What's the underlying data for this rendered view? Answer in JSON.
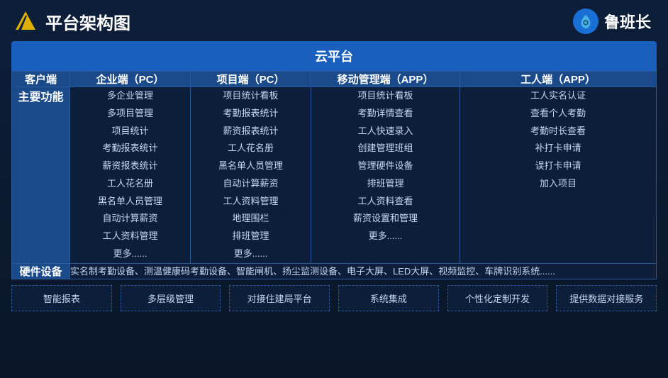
{
  "header": {
    "title": "平台架构图",
    "brand_name": "鲁班长"
  },
  "cloud_platform_label": "云平台",
  "columns": {
    "client": "客户端",
    "enterprise_pc": "企业端（PC）",
    "project_pc": "项目端（PC）",
    "mobile_app": "移动管理端（APP）",
    "worker_app": "工人端（APP）"
  },
  "main_function_label": "主要功能",
  "hardware_label": "硬件设备",
  "enterprise_functions": [
    "多企业管理",
    "多项目管理",
    "项目统计",
    "考勤报表统计",
    "薪资报表统计",
    "工人花名册",
    "黑名单人员管理",
    "自动计算薪资",
    "工人资料管理",
    "更多......"
  ],
  "project_functions": [
    "项目统计看板",
    "考勤报表统计",
    "薪资报表统计",
    "工人花名册",
    "黑名单人员管理",
    "自动计算薪资",
    "工人资料管理",
    "地理围栏",
    "排班管理",
    "更多......"
  ],
  "mobile_functions": [
    "项目统计看板",
    "考勤详情查看",
    "工人快速录入",
    "创建管理班组",
    "管理硬件设备",
    "排班管理",
    "工人资料查看",
    "薪资设置和管理",
    "更多......"
  ],
  "worker_functions": [
    "工人实名认证",
    "查看个人考勤",
    "考勤时长查看",
    "补打卡申请",
    "误打卡申请",
    "加入项目"
  ],
  "hardware_content": "实名制考勤设备、测温健康码考勤设备、智能闸机、扬尘监测设备、电子大屏、LED大屏、视频监控、车牌识别系统......",
  "bottom_features": [
    "智能报表",
    "多层级管理",
    "对接住建局平台",
    "系统集成",
    "个性化定制开发",
    "提供数据对接服务"
  ]
}
